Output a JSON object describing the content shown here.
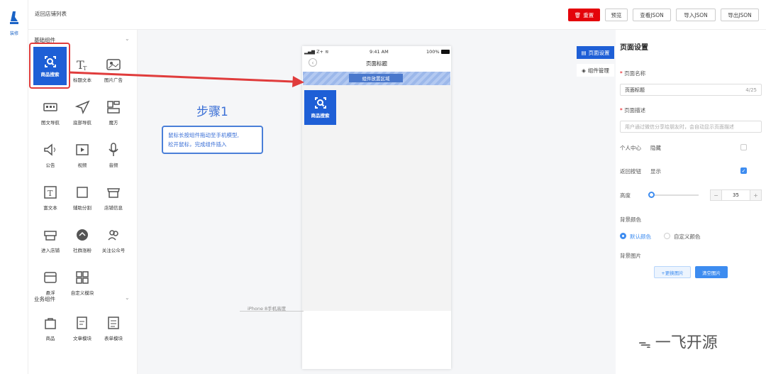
{
  "rail": {
    "label": "装修",
    "icon": "brush-icon"
  },
  "topbar": {
    "back_link": "返回店铺列表",
    "reset_label": "重置",
    "preview_label": "预览",
    "view_json_label": "查看JSON",
    "import_json_label": "导入JSON",
    "export_json_label": "导出JSON"
  },
  "components": {
    "basic_title": "基础组件",
    "business_title": "业务组件",
    "basic": [
      {
        "label": "商品搜索",
        "icon": "product-search-icon"
      },
      {
        "label": "标题文本",
        "icon": "title-text-icon"
      },
      {
        "label": "图片广告",
        "icon": "image-ad-icon"
      },
      {
        "label": "图文导航",
        "icon": "image-nav-icon"
      },
      {
        "label": "底部导航",
        "icon": "bottom-nav-icon"
      },
      {
        "label": "魔方",
        "icon": "cube-icon"
      },
      {
        "label": "公告",
        "icon": "announcement-icon"
      },
      {
        "label": "视频",
        "icon": "video-icon"
      },
      {
        "label": "音频",
        "icon": "audio-icon"
      },
      {
        "label": "富文本",
        "icon": "rich-text-icon"
      },
      {
        "label": "辅助分割",
        "icon": "divider-icon"
      },
      {
        "label": "店铺信息",
        "icon": "store-info-icon"
      },
      {
        "label": "进入店铺",
        "icon": "enter-store-icon"
      },
      {
        "label": "社群涨粉",
        "icon": "community-icon"
      },
      {
        "label": "关注公众号",
        "icon": "follow-account-icon"
      },
      {
        "label": "悬浮",
        "icon": "float-icon"
      },
      {
        "label": "自定义模块",
        "icon": "custom-module-icon"
      }
    ],
    "business": [
      {
        "label": "商品",
        "icon": "product-icon"
      },
      {
        "label": "文章模块",
        "icon": "article-icon"
      },
      {
        "label": "表单模块",
        "icon": "form-icon"
      }
    ]
  },
  "canvas": {
    "step_title": "步骤1",
    "step_line1": "鼠标长按组件拖动至手机模型,",
    "step_line2": "松开鼠标，完成组件插入",
    "iphone_label": "iPhone 8手机高度",
    "phone": {
      "carrier": "Z+",
      "time": "9:41 AM",
      "battery": "100%",
      "page_title": "页面标题",
      "drop_zone_label": "组件放置区域",
      "placed_component": "商品搜索"
    }
  },
  "side_tabs": {
    "page_settings": "页面设置",
    "component_manage": "组件管理"
  },
  "settings": {
    "title": "页面设置",
    "name_label": "页面名称",
    "name_value": "页面标题",
    "name_count": "4/25",
    "desc_label": "页面描述",
    "desc_placeholder": "用户通过微信分享给朋友时，会自动显示页面描述",
    "personal_center_label": "个人中心",
    "personal_center_value": "隐藏",
    "back_button_label": "返回按钮",
    "back_button_value": "显示",
    "height_label": "高度",
    "height_value": "35",
    "minus": "−",
    "plus": "+",
    "bg_color_label": "背景颜色",
    "bg_default": "默认颜色",
    "bg_custom": "自定义颜色",
    "bg_image_label": "背景图片",
    "replace_image": "+更换图片",
    "clear_image": "清空图片"
  },
  "watermark": "一飞开源",
  "colors": {
    "primary": "#1e5fd6",
    "danger": "#e4040b",
    "annotation": "#e03c3c"
  }
}
